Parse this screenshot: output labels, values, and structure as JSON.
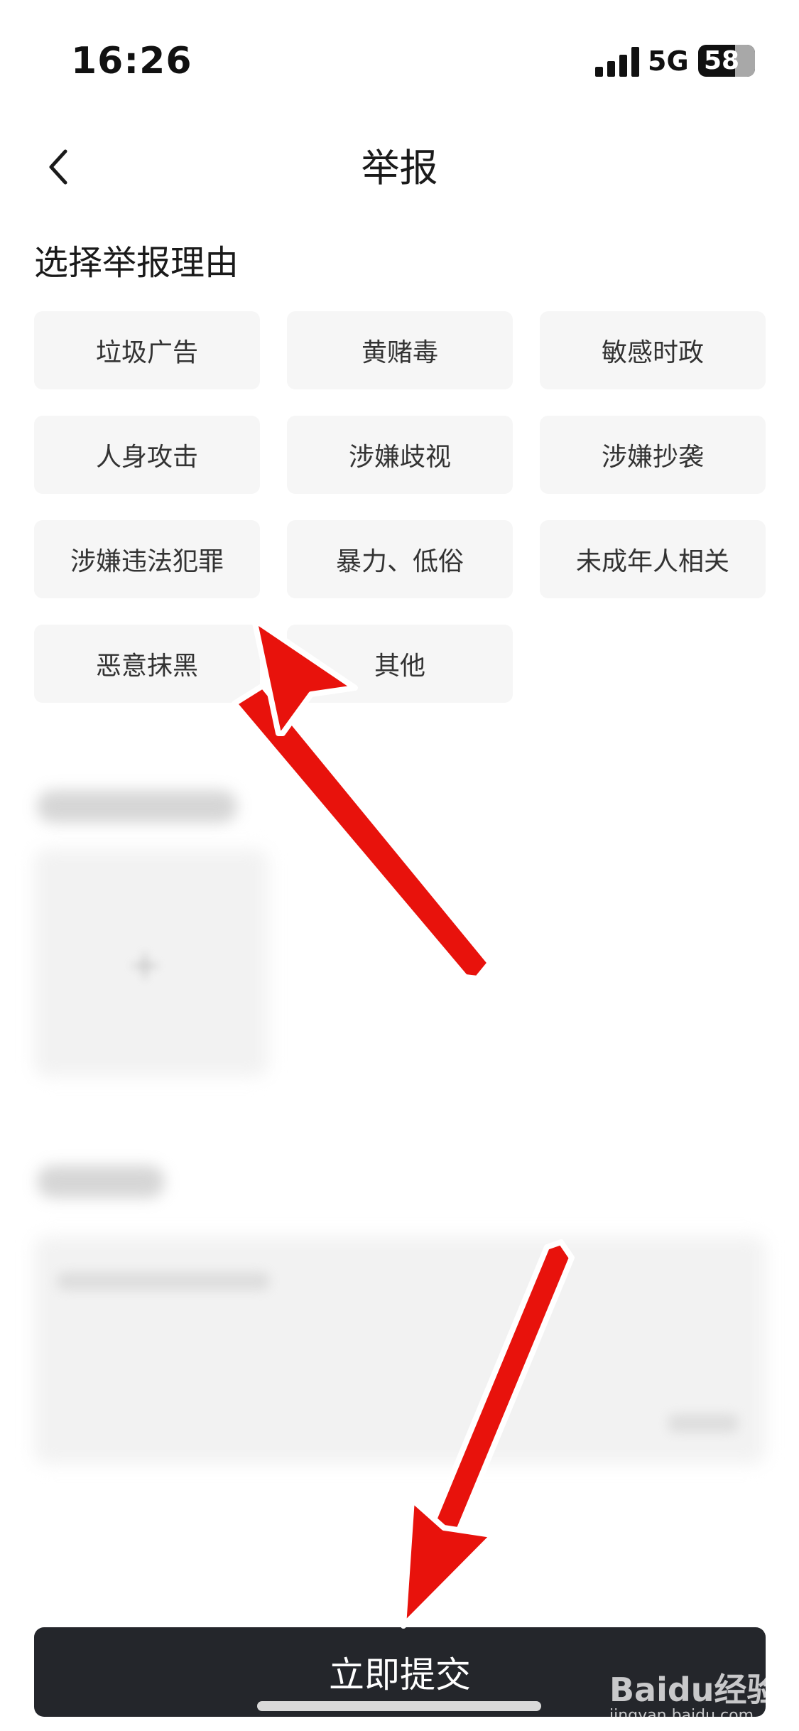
{
  "status": {
    "time": "16:26",
    "network": "5G",
    "battery": "58"
  },
  "nav": {
    "title": "举报",
    "back_icon": "chevron-left-icon"
  },
  "section": {
    "title": "选择举报理由"
  },
  "reasons": [
    "垃圾广告",
    "黄赌毒",
    "敏感时政",
    "人身攻击",
    "涉嫌歧视",
    "涉嫌抄袭",
    "涉嫌违法犯罪",
    "暴力、低俗",
    "未成年人相关",
    "恶意抹黑",
    "其他"
  ],
  "submit": {
    "label": "立即提交"
  },
  "watermark": {
    "brand": "Baidu经验",
    "url": "jingyan.baidu.com"
  },
  "annotation_color": "#e8120c"
}
